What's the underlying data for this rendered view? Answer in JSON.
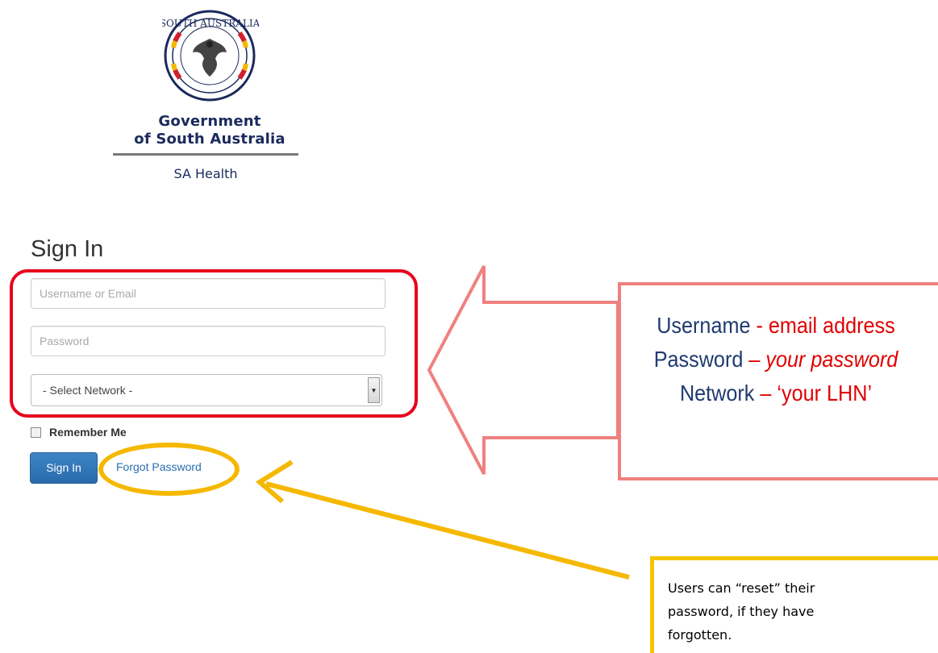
{
  "logo": {
    "seal_text": "SOUTH AUSTRALIA",
    "line1": "Government",
    "line2": "of South Australia",
    "department": "SA Health"
  },
  "signin": {
    "title": "Sign In",
    "username_placeholder": "Username or Email",
    "password_placeholder": "Password",
    "network_selected": "- Select Network -",
    "remember_label": "Remember Me",
    "signin_button": "Sign In",
    "forgot_link": "Forgot Password"
  },
  "callouts": {
    "credentials": {
      "line1_label": "Username",
      "line1_sep": " - ",
      "line1_value": "email address",
      "line2_label": "Password",
      "line2_sep": " – ",
      "line2_value": "your password",
      "line3_label": "Network",
      "line3_sep": " – ",
      "line3_value": "‘your LHN’"
    },
    "reset": {
      "text": "Users can “reset” their password, if they have forgotten."
    }
  },
  "colors": {
    "highlight_red": "#e8001c",
    "highlight_yellow": "#f5b800",
    "callout_red_border": "#f08080",
    "button_blue": "#2a6aab",
    "gov_navy": "#1a2a5c"
  },
  "icons": {
    "seal": "south-australia-seal-icon",
    "select_arrow": "chevron-down-icon",
    "checkbox": "checkbox-icon"
  }
}
